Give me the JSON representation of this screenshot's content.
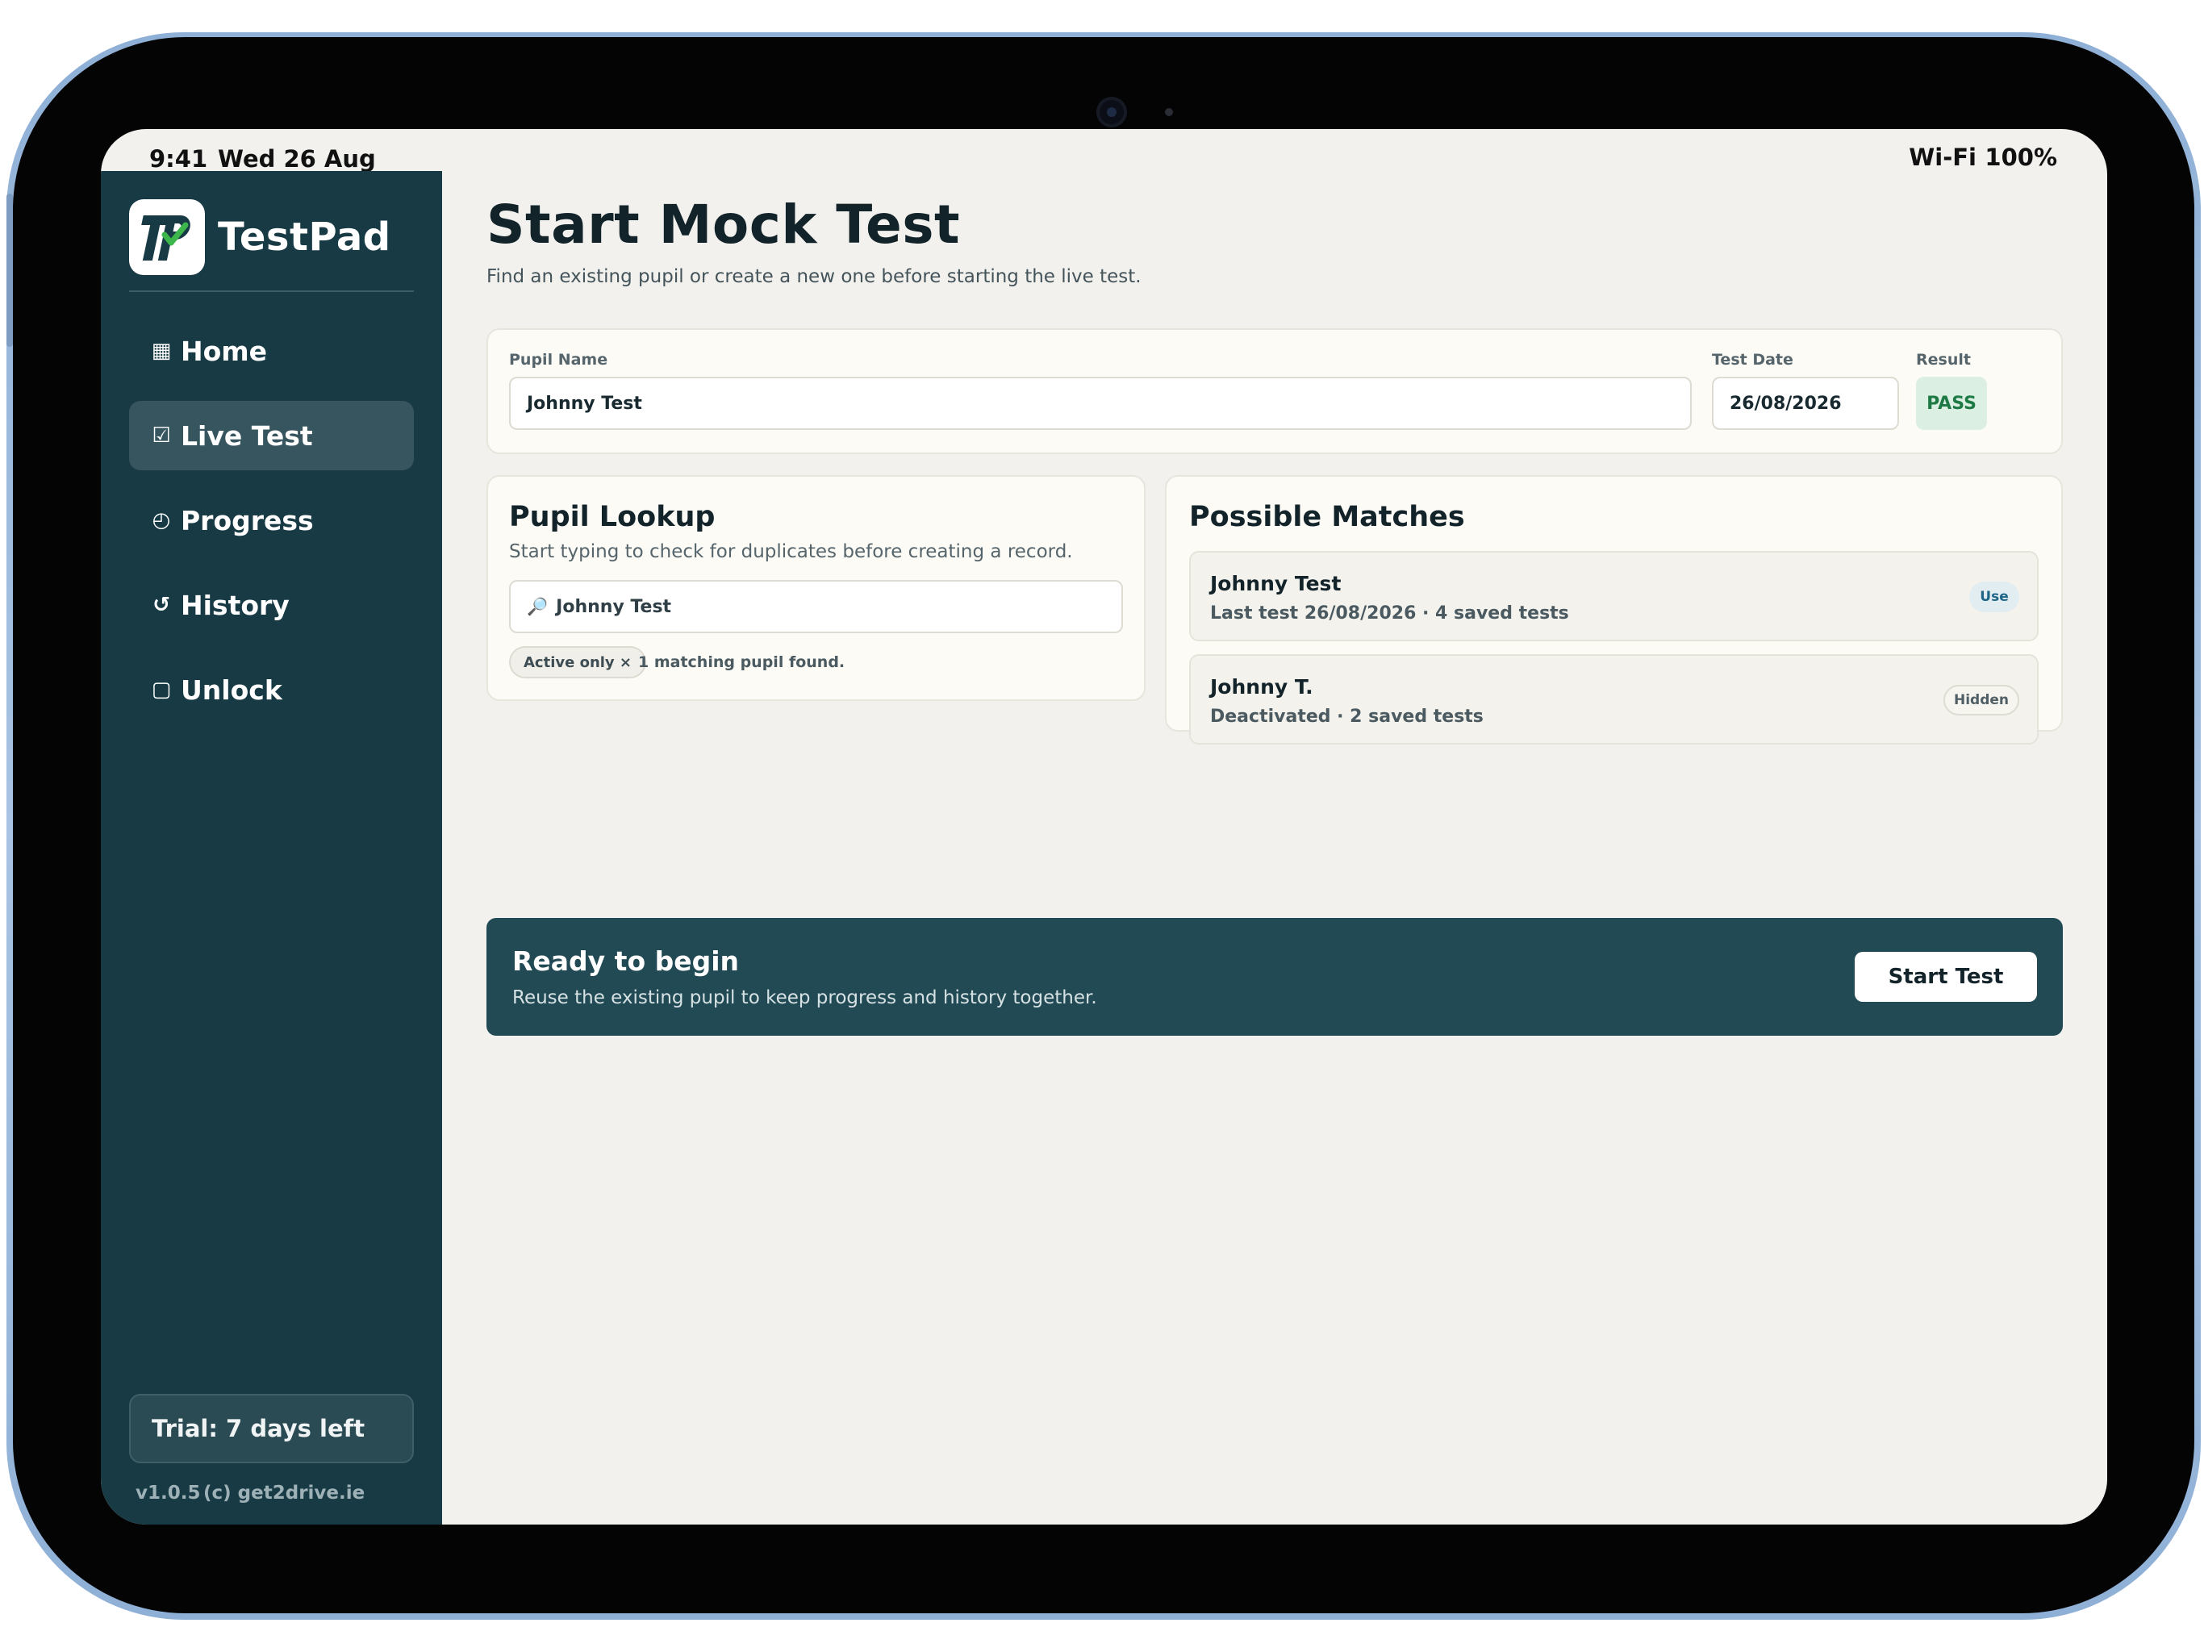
{
  "status_bar": {
    "time": "9:41",
    "date": "Wed 26 Aug",
    "wifi": "Wi-Fi",
    "battery": "100%"
  },
  "sidebar": {
    "brand_name": "TestPad",
    "logo_letters": "TP",
    "nav": [
      {
        "label": "Home",
        "icon": "▦",
        "icon_name": "grid-icon"
      },
      {
        "label": "Live Test",
        "icon": "☑",
        "icon_name": "checkbox-icon",
        "active": true
      },
      {
        "label": "Progress",
        "icon": "◴",
        "icon_name": "clock-icon"
      },
      {
        "label": "History",
        "icon": "↺",
        "icon_name": "history-icon"
      },
      {
        "label": "Unlock",
        "icon": "▢",
        "icon_name": "unlock-square-icon"
      }
    ],
    "trial": "Trial: 7 days left",
    "version": "v1.0.5",
    "copyright": "(c) get2drive.ie"
  },
  "page": {
    "title": "Start Mock Test",
    "subtitle": "Find an existing pupil or create a new one before starting the live test."
  },
  "form": {
    "pupil_name_label": "Pupil Name",
    "pupil_name_value": "Johnny Test",
    "test_date_label": "Test Date",
    "test_date_value": "26/08/2026",
    "result_label": "Result",
    "result_value": "PASS"
  },
  "lookup": {
    "title": "Pupil Lookup",
    "description": "Start typing to check for duplicates before creating a record.",
    "search_icon": "🔎",
    "search_value": "Johnny Test",
    "filter_chip": "Active only ×",
    "match_count": "1 matching pupil found."
  },
  "matches": {
    "title": "Possible Matches",
    "items": [
      {
        "name": "Johnny Test",
        "meta": "Last test 26/08/2026 · 4 saved tests",
        "action": "Use"
      },
      {
        "name": "Johnny T.",
        "meta": "Deactivated · 2 saved tests",
        "action": "Hidden"
      }
    ]
  },
  "banner": {
    "title": "Ready to begin",
    "description": "Reuse the existing pupil to keep progress and history together.",
    "button": "Start Test"
  },
  "colors": {
    "sidebar_bg": "#173a45",
    "banner_bg": "#224a55",
    "pass_green": "#1d7a45",
    "device_frame": "#a8c3e3"
  }
}
